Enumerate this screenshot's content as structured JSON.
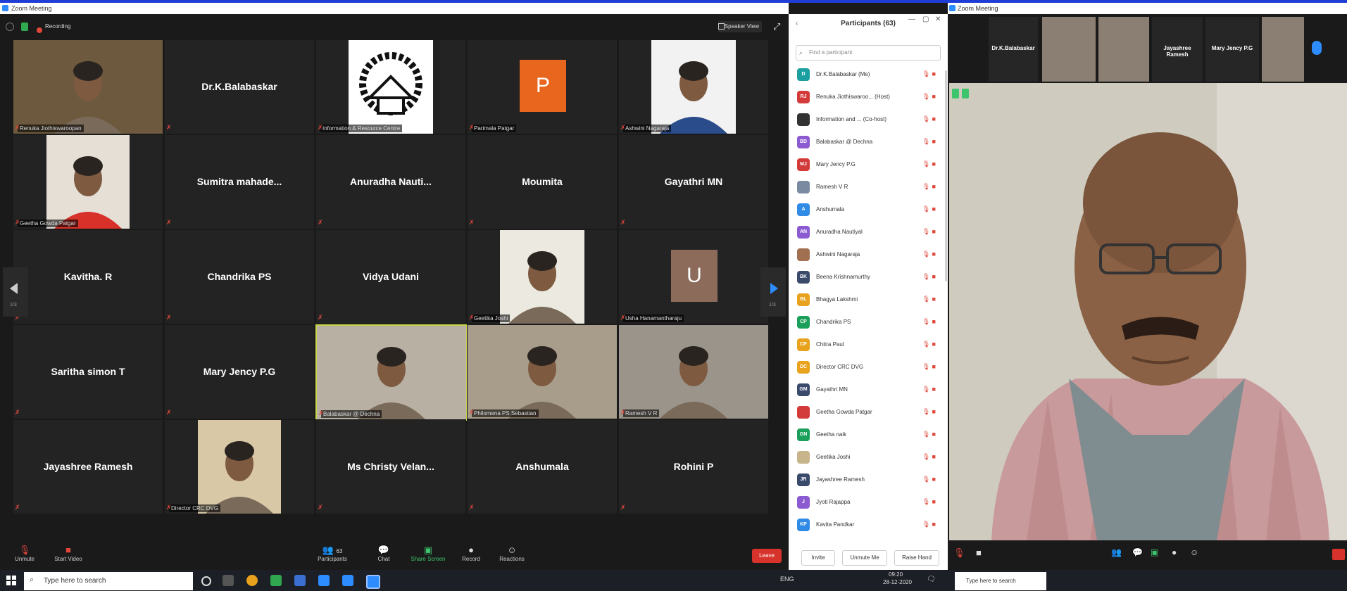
{
  "left_window": {
    "title": "Zoom Meeting",
    "recording_label": "Recording",
    "view_button": "Speaker View",
    "page_left": "1/3",
    "page_right": "1/3",
    "tiles": [
      {
        "name": "",
        "label": "Renuka Jiothiswaroopan",
        "kind": "photo",
        "color": "#6d5a3e"
      },
      {
        "name": "Dr.K.Balabaskar",
        "label": "",
        "kind": "name"
      },
      {
        "name": "",
        "label": "Information & Resource Centre",
        "kind": "irc"
      },
      {
        "name": "",
        "label": "Parimala Patgar",
        "kind": "avatar",
        "letter": "P",
        "color": "#e8661d"
      },
      {
        "name": "",
        "label": "Ashwini Nagaraja",
        "kind": "photo",
        "color": "#f2f2f2"
      },
      {
        "name": "",
        "label": "Geetha Gowda Patgar",
        "kind": "photo",
        "color": "#e6dfd6"
      },
      {
        "name": "Sumitra  mahade...",
        "label": "",
        "kind": "name"
      },
      {
        "name": "Anuradha  Nauti...",
        "label": "",
        "kind": "name"
      },
      {
        "name": "Moumita",
        "label": "",
        "kind": "name"
      },
      {
        "name": "Gayathri MN",
        "label": "",
        "kind": "name"
      },
      {
        "name": "Kavitha. R",
        "label": "",
        "kind": "name"
      },
      {
        "name": "Chandrika PS",
        "label": "",
        "kind": "name"
      },
      {
        "name": "Vidya Udani",
        "label": "",
        "kind": "name"
      },
      {
        "name": "",
        "label": "Geetika Joshi",
        "kind": "photo",
        "color": "#ece9e0"
      },
      {
        "name": "",
        "label": "Usha Hanamantharaju",
        "kind": "avatar",
        "letter": "U",
        "color": "#8c6b5a"
      },
      {
        "name": "Saritha simon T",
        "label": "",
        "kind": "name"
      },
      {
        "name": "Mary Jency P.G",
        "label": "",
        "kind": "name"
      },
      {
        "name": "",
        "label": "Balabaskar @ Dechna",
        "kind": "photo",
        "color": "#b7b0a3",
        "active": true
      },
      {
        "name": "",
        "label": "Philomena PS Sebastian",
        "kind": "photo",
        "color": "#a89d8b"
      },
      {
        "name": "",
        "label": "Ramesh V R",
        "kind": "photo",
        "color": "#9b948a"
      },
      {
        "name": "Jayashree Ramesh",
        "label": "",
        "kind": "name"
      },
      {
        "name": "",
        "label": "Director CRC DVG",
        "kind": "photo",
        "color": "#d8c8a6"
      },
      {
        "name": "Ms Christy Velan...",
        "label": "",
        "kind": "name"
      },
      {
        "name": "Anshumala",
        "label": "",
        "kind": "name"
      },
      {
        "name": "Rohini P",
        "label": "",
        "kind": "name"
      }
    ],
    "toolbar": {
      "unmute": "Unmute",
      "start_video": "Start Video",
      "participants": "Participants",
      "participants_count": "63",
      "chat": "Chat",
      "share_screen": "Share Screen",
      "record": "Record",
      "reactions": "Reactions",
      "leave": "Leave"
    }
  },
  "participants_panel": {
    "title": "Participants (63)",
    "search_placeholder": "Find a participant",
    "rows": [
      {
        "initials": "D",
        "name": "Dr.K.Balabaskar (Me)",
        "color": "#1aa0a0"
      },
      {
        "initials": "RJ",
        "name": "Renuka Jiothiswaroo... (Host)",
        "color": "#d33b3b"
      },
      {
        "initials": "",
        "name": "Information and ... (Co-host)",
        "color": "#333333"
      },
      {
        "initials": "BD",
        "name": "Balabaskar @ Dechna",
        "color": "#8c5ad1"
      },
      {
        "initials": "MJ",
        "name": "Mary Jency P.G",
        "color": "#d33b3b"
      },
      {
        "initials": "",
        "name": "Ramesh V R",
        "color": "#7a8aa0"
      },
      {
        "initials": "A",
        "name": "Anshumala",
        "color": "#2f8be6"
      },
      {
        "initials": "AN",
        "name": "Anuradha Nautiyal",
        "color": "#8c5ad1"
      },
      {
        "initials": "",
        "name": "Ashwini Nagaraja",
        "color": "#a07050"
      },
      {
        "initials": "BK",
        "name": "Beena Krishnamurthy",
        "color": "#3a4a6a"
      },
      {
        "initials": "BL",
        "name": "Bhagya Lakshmi",
        "color": "#e8a21d"
      },
      {
        "initials": "CP",
        "name": "Chandrika PS",
        "color": "#1aa05a"
      },
      {
        "initials": "CP",
        "name": "Chitra Paul",
        "color": "#e8a21d"
      },
      {
        "initials": "DC",
        "name": "Director CRC DVG",
        "color": "#e8a21d"
      },
      {
        "initials": "GM",
        "name": "Gayathri MN",
        "color": "#3a4a6a"
      },
      {
        "initials": "",
        "name": "Geetha Gowda Patgar",
        "color": "#d33b3b"
      },
      {
        "initials": "GN",
        "name": "Geetha naik",
        "color": "#1aa05a"
      },
      {
        "initials": "",
        "name": "Geetika Joshi",
        "color": "#c8b48a"
      },
      {
        "initials": "JR",
        "name": "Jayashree Ramesh",
        "color": "#3a4a6a"
      },
      {
        "initials": "J",
        "name": "Jyoti Rajappa",
        "color": "#8c5ad1"
      },
      {
        "initials": "KP",
        "name": "Kavita Pandkar",
        "color": "#2f8be6"
      }
    ],
    "invite": "Invite",
    "unmute_me": "Unmute Me",
    "raise_hand": "Raise Hand"
  },
  "right_window": {
    "title": "Zoom Meeting",
    "thumbnails": [
      "Dr.K.Balabaskar",
      "",
      "",
      "Jayashree Ramesh",
      "Mary Jency P.G",
      ""
    ]
  },
  "taskbar": {
    "search_placeholder": "Type here to search",
    "time": "09:20",
    "date": "28-12-2020",
    "lang": "ENG",
    "right_search": "Type here to search"
  }
}
